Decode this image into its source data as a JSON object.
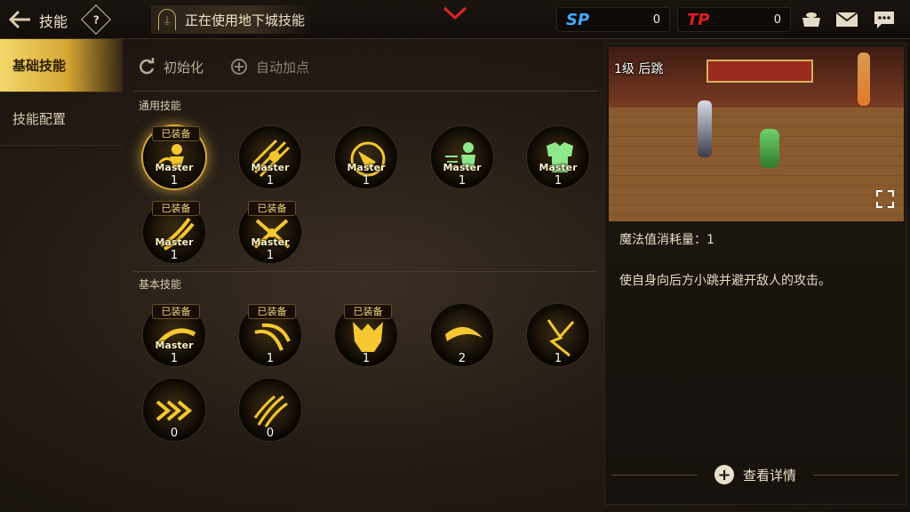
{
  "header": {
    "title": "技能",
    "help_icon": "?",
    "dungeon_banner": "正在使用地下城技能",
    "sp": {
      "label": "SP",
      "value": "0"
    },
    "tp": {
      "label": "TP",
      "value": "0"
    }
  },
  "sidebar": {
    "items": [
      {
        "label": "基础技能",
        "active": true
      },
      {
        "label": "技能配置",
        "active": false
      }
    ]
  },
  "actions": {
    "reset": "初始化",
    "auto_add": "自动加点"
  },
  "sections": {
    "common": "通用技能",
    "basic": "基本技能"
  },
  "skills": {
    "common": [
      {
        "equipped": "已装备",
        "master": "Master",
        "level": "1",
        "icon": "jump-back-icon"
      },
      {
        "equipped": "",
        "master": "Master",
        "level": "1",
        "icon": "slash-icon"
      },
      {
        "equipped": "",
        "master": "Master",
        "level": "1",
        "icon": "spin-kick-icon"
      },
      {
        "equipped": "",
        "master": "Master",
        "level": "1",
        "icon": "dash-icon"
      },
      {
        "equipped": "",
        "master": "Master",
        "level": "1",
        "icon": "armor-icon"
      },
      {
        "equipped": "已装备",
        "master": "Master",
        "level": "1",
        "icon": "claw-icon"
      },
      {
        "equipped": "已装备",
        "master": "Master",
        "level": "1",
        "icon": "burst-icon"
      }
    ],
    "basic": [
      {
        "equipped": "已装备",
        "master": "Master",
        "level": "1",
        "icon": "wave-icon"
      },
      {
        "equipped": "已装备",
        "master": "",
        "level": "1",
        "icon": "swipe-icon"
      },
      {
        "equipped": "已装备",
        "master": "",
        "level": "1",
        "icon": "demon-icon"
      },
      {
        "equipped": "",
        "master": "",
        "level": "2",
        "icon": "crescent-icon"
      },
      {
        "equipped": "",
        "master": "",
        "level": "1",
        "icon": "lightning-icon"
      },
      {
        "equipped": "",
        "master": "",
        "level": "0",
        "icon": "arrows-icon"
      },
      {
        "equipped": "",
        "master": "",
        "level": "0",
        "icon": "triple-slash-icon"
      }
    ]
  },
  "detail": {
    "skill_level_name": "1级 后跳",
    "mp_cost": "魔法值消耗量：1",
    "description": "使自身向后方小跳并避开敌人的攻击。",
    "view_details": "查看详情"
  },
  "colors": {
    "accent_gold": "#d6a632",
    "sp_blue": "#3fa9ff",
    "tp_red": "#e01e24"
  }
}
